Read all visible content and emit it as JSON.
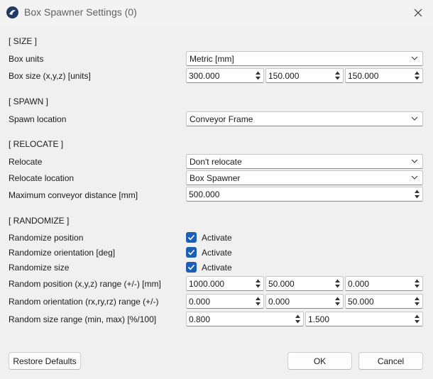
{
  "window": {
    "title": "Box Spawner Settings (0)"
  },
  "size": {
    "header": "[ SIZE ]",
    "units_label": "Box units",
    "units_value": "Metric [mm]",
    "box_size_label": "Box size (x,y,z) [units]",
    "box_size_values": [
      "300.000",
      "150.000",
      "150.000"
    ]
  },
  "spawn": {
    "header": "[ SPAWN ]",
    "location_label": "Spawn location",
    "location_value": "Conveyor Frame"
  },
  "relocate": {
    "header": "[ RELOCATE ]",
    "relocate_label": "Relocate",
    "relocate_value": "Don't relocate",
    "location_label": "Relocate location",
    "location_value": "Box Spawner",
    "distance_label": "Maximum conveyor distance [mm]",
    "distance_value": "500.000"
  },
  "randomize": {
    "header": "[ RANDOMIZE ]",
    "position_label": "Randomize position",
    "orientation_label": "Randomize orientation [deg]",
    "size_label": "Randomize size",
    "activate_label": "Activate",
    "position_checked": true,
    "orientation_checked": true,
    "size_checked": true,
    "pos_range_label": "Random position (x,y,z) range (+/-) [mm]",
    "pos_range_values": [
      "1000.000",
      "50.000",
      "0.000"
    ],
    "orient_range_label": "Random orientation (rx,ry,rz) range (+/-)",
    "orient_range_values": [
      "0.000",
      "0.000",
      "50.000"
    ],
    "size_range_label": "Random size range (min, max) [%/100]",
    "size_range_values": [
      "0.800",
      "1.500"
    ]
  },
  "buttons": {
    "restore": "Restore Defaults",
    "ok": "OK",
    "cancel": "Cancel"
  },
  "colors": {
    "accent": "#1a5fb4",
    "background": "#f0f0f0"
  }
}
